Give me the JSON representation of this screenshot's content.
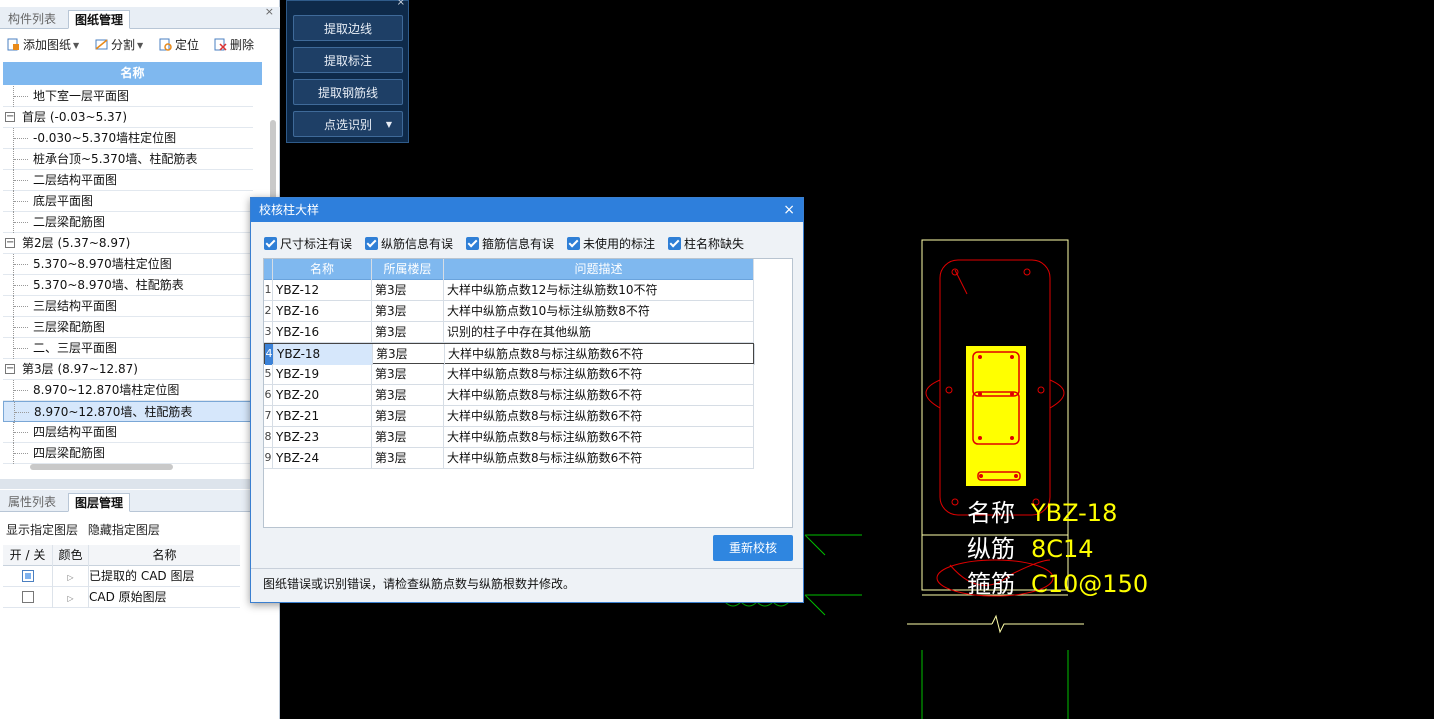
{
  "left_panel": {
    "tabs": [
      "构件列表",
      "图纸管理"
    ],
    "toolbar": {
      "add": "添加图纸",
      "split": "分割",
      "locate": "定位",
      "delete": "删除"
    },
    "tree_header": "名称",
    "tree": [
      {
        "label": "地下室一层平面图",
        "kind": "child"
      },
      {
        "label": "首层 (-0.03~5.37)",
        "kind": "group"
      },
      {
        "label": "-0.030~5.370墙柱定位图",
        "kind": "child"
      },
      {
        "label": "桩承台顶~5.370墙、柱配筋表",
        "kind": "child"
      },
      {
        "label": "二层结构平面图",
        "kind": "child"
      },
      {
        "label": "底层平面图",
        "kind": "child"
      },
      {
        "label": "二层梁配筋图",
        "kind": "child"
      },
      {
        "label": "第2层 (5.37~8.97)",
        "kind": "group"
      },
      {
        "label": "5.370~8.970墙柱定位图",
        "kind": "child"
      },
      {
        "label": "5.370~8.970墙、柱配筋表",
        "kind": "child"
      },
      {
        "label": "三层结构平面图",
        "kind": "child"
      },
      {
        "label": "三层梁配筋图",
        "kind": "child"
      },
      {
        "label": "二、三层平面图",
        "kind": "child"
      },
      {
        "label": "第3层 (8.97~12.87)",
        "kind": "group"
      },
      {
        "label": "8.970~12.870墙柱定位图",
        "kind": "child"
      },
      {
        "label": "8.970~12.870墙、柱配筋表",
        "kind": "child",
        "selected": true
      },
      {
        "label": "四层结构平面图",
        "kind": "child"
      },
      {
        "label": "四层梁配筋图",
        "kind": "child"
      }
    ],
    "bottom_tabs": [
      "属性列表",
      "图层管理"
    ],
    "layer_tools": {
      "show": "显示指定图层",
      "hide": "隐藏指定图层"
    },
    "layer_table": {
      "headers": [
        "开 / 关",
        "颜色",
        "名称"
      ],
      "rows": [
        {
          "name": "已提取的 CAD 图层",
          "on": true
        },
        {
          "name": "CAD 原始图层",
          "on": false
        }
      ]
    }
  },
  "extract_panel": {
    "buttons": [
      "提取边线",
      "提取标注",
      "提取钢筋线",
      "点选识别"
    ]
  },
  "dialog": {
    "title": "校核柱大样",
    "close": "×",
    "filters": [
      "尺寸标注有误",
      "纵筋信息有误",
      "箍筋信息有误",
      "未使用的标注",
      "柱名称缺失"
    ],
    "headers": [
      "名称",
      "所属楼层",
      "问题描述"
    ],
    "rows": [
      {
        "n": "1",
        "name": "YBZ-12",
        "floor": "第3层",
        "desc": "大样中纵筋点数12与标注纵筋数10不符"
      },
      {
        "n": "2",
        "name": "YBZ-16",
        "floor": "第3层",
        "desc": "大样中纵筋点数10与标注纵筋数8不符"
      },
      {
        "n": "3",
        "name": "YBZ-16",
        "floor": "第3层",
        "desc": "识别的柱子中存在其他纵筋"
      },
      {
        "n": "4",
        "name": "YBZ-18",
        "floor": "第3层",
        "desc": "大样中纵筋点数8与标注纵筋数6不符",
        "selected": true
      },
      {
        "n": "5",
        "name": "YBZ-19",
        "floor": "第3层",
        "desc": "大样中纵筋点数8与标注纵筋数6不符"
      },
      {
        "n": "6",
        "name": "YBZ-20",
        "floor": "第3层",
        "desc": "大样中纵筋点数8与标注纵筋数6不符"
      },
      {
        "n": "7",
        "name": "YBZ-21",
        "floor": "第3层",
        "desc": "大样中纵筋点数8与标注纵筋数6不符"
      },
      {
        "n": "8",
        "name": "YBZ-23",
        "floor": "第3层",
        "desc": "大样中纵筋点数8与标注纵筋数6不符"
      },
      {
        "n": "9",
        "name": "YBZ-24",
        "floor": "第3层",
        "desc": "大样中纵筋点数8与标注纵筋数6不符"
      }
    ],
    "recheck_button": "重新校核",
    "status": "图纸错误或识别错误，请检查纵筋点数与纵筋根数并修改。"
  },
  "cad": {
    "labels": [
      {
        "key": "名称",
        "value": "YBZ-18"
      },
      {
        "key": "纵筋",
        "value": "8C14"
      },
      {
        "key": "箍筋",
        "value": "C10@150"
      }
    ],
    "colors": {
      "background": "#000000",
      "outline": "#ffffaa",
      "rebar": "#e00000",
      "highlight": "#ffff00",
      "green": "#00c000"
    }
  }
}
